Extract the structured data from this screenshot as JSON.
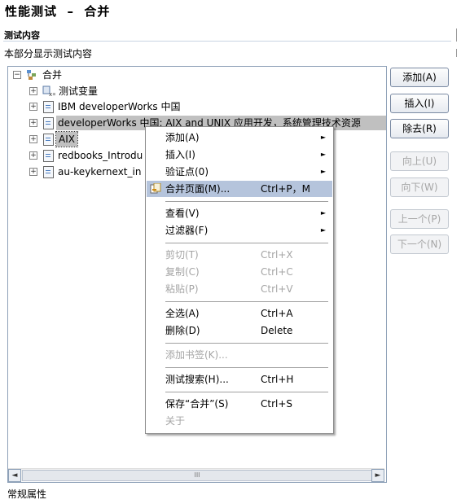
{
  "page": {
    "title": "性能测试  –  合并",
    "section_title": "测试内容",
    "section_desc": "本部分显示测试内容",
    "footer_link": "常规属性"
  },
  "tree": {
    "root_label": "合并",
    "items": [
      {
        "label": "测试变量"
      },
      {
        "label": "IBM developerWorks 中国"
      },
      {
        "label": "developerWorks 中国: AIX and UNIX 应用开发，系统管理技术资源"
      },
      {
        "label": "AIX"
      },
      {
        "label": "redbooks_Introdu"
      },
      {
        "label": "au-keykernext_in"
      }
    ]
  },
  "buttons": {
    "add": "添加(A)",
    "insert": "插入(I)",
    "remove": "除去(R)",
    "up": "向上(U)",
    "down": "向下(W)",
    "prev": "上一个(P)",
    "next": "下一个(N)"
  },
  "context_menu": {
    "add": "添加(A)",
    "insert": "插入(I)",
    "verification_point": "验证点(0)",
    "merge_page": "合并页面(M)...",
    "merge_page_shortcut": "Ctrl+P，M",
    "view": "查看(V)",
    "filter": "过滤器(F)",
    "cut": "剪切(T)",
    "cut_shortcut": "Ctrl+X",
    "copy": "复制(C)",
    "copy_shortcut": "Ctrl+C",
    "paste": "粘贴(P)",
    "paste_shortcut": "Ctrl+V",
    "select_all": "全选(A)",
    "select_all_shortcut": "Ctrl+A",
    "delete": "删除(D)",
    "delete_shortcut": "Delete",
    "add_bookmark": "添加书签(K)...",
    "test_search": "测试搜索(H)...",
    "test_search_shortcut": "Ctrl+H",
    "save": "保存“合并”(S)",
    "save_shortcut": "Ctrl+S",
    "about": "关于"
  },
  "scrollbar": {
    "grip": "III"
  },
  "icons": {
    "submenu_arrow": "►",
    "collapse": "−",
    "expand": "+",
    "scroll_left": "◄",
    "scroll_right": "►"
  }
}
